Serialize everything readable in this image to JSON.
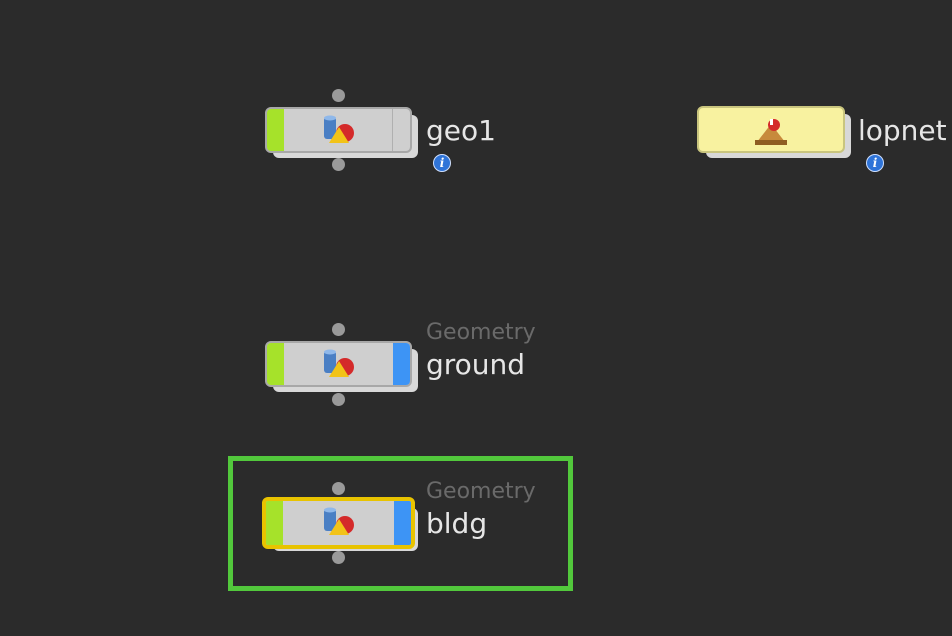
{
  "nodes": {
    "geo1": {
      "name": "geo1",
      "icon": "geometry-icon",
      "display_flag_color": "#a6e22a",
      "has_info_badge": true
    },
    "lopnet": {
      "name": "lopnet",
      "icon": "lopnet-icon",
      "color": "#f8f2a0",
      "has_info_badge": true
    },
    "ground": {
      "type_label": "Geometry",
      "name": "ground",
      "icon": "geometry-icon",
      "display_flag_color": "#a6e22a",
      "render_flag_color": "#3d94f5"
    },
    "bldg": {
      "type_label": "Geometry",
      "name": "bldg",
      "icon": "geometry-icon",
      "display_flag_color": "#a6e22a",
      "render_flag_color": "#3d94f5",
      "selected": true
    }
  },
  "highlight": {
    "color": "#52c83c",
    "target": "bldg"
  },
  "info_badge": {
    "glyph": "i",
    "color": "#2f74d8"
  },
  "colors": {
    "background": "#2b2b2b",
    "selection_outline": "#e8c300"
  }
}
